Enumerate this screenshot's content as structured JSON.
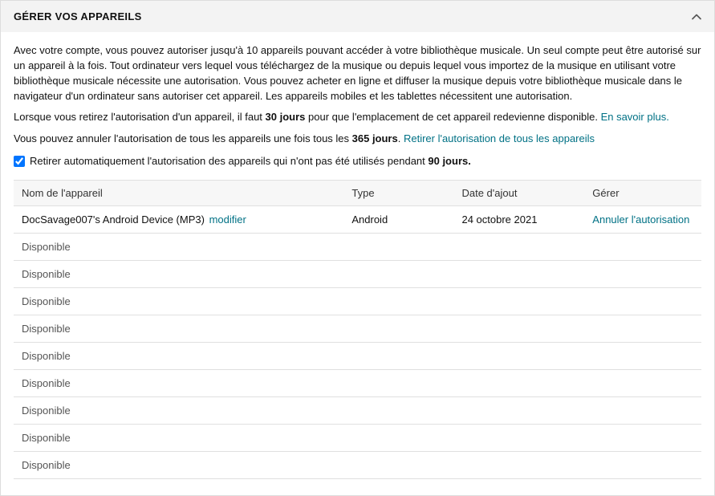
{
  "header": {
    "title": "GÉRER VOS APPAREILS"
  },
  "intro": {
    "p1": "Avec votre compte, vous pouvez autoriser jusqu'à 10 appareils pouvant accéder à votre bibliothèque musicale. Un seul compte peut être autorisé sur un appareil à la fois. Tout ordinateur vers lequel vous téléchargez de la musique ou depuis lequel vous importez de la musique en utilisant votre bibliothèque musicale nécessite une autorisation. Vous pouvez acheter en ligne et diffuser la musique depuis votre bibliothèque musicale dans le navigateur d'un ordinateur sans autoriser cet appareil. Les appareils mobiles et les tablettes nécessitent une autorisation.",
    "p2_prefix": "Lorsque vous retirez l'autorisation d'un appareil, il faut ",
    "p2_bold": "30 jours",
    "p2_suffix": " pour que l'emplacement de cet appareil redevienne disponible. ",
    "p2_link": "En savoir plus.",
    "p3_prefix": "Vous pouvez annuler l'autorisation de tous les appareils une fois tous les ",
    "p3_bold": "365 jours",
    "p3_suffix": ". ",
    "p3_link": "Retirer l'autorisation de tous les appareils"
  },
  "auto_remove": {
    "prefix": "Retirer automatiquement l'autorisation des appareils qui n'ont pas été utilisés pendant ",
    "bold": "90 jours."
  },
  "table": {
    "headers": {
      "name": "Nom de l'appareil",
      "type": "Type",
      "date": "Date d'ajout",
      "manage": "Gérer"
    },
    "device": {
      "name": "DocSavage007's Android Device (MP3)",
      "modify": "modifier",
      "type": "Android",
      "date": "24 octobre 2021",
      "deauth": "Annuler l'autorisation"
    },
    "available_label": "Disponible"
  }
}
